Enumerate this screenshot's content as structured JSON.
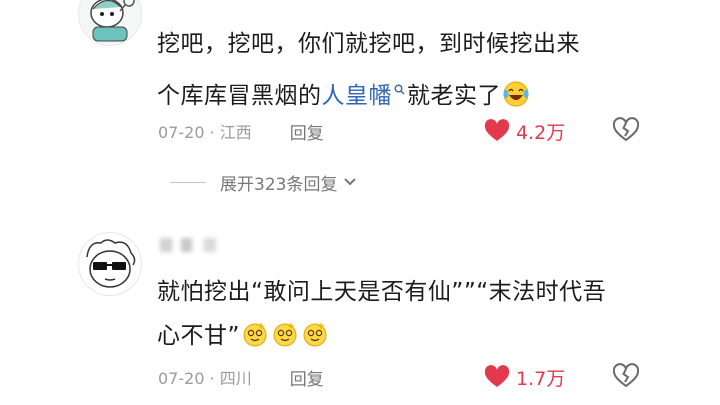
{
  "comments": [
    {
      "line1": "挖吧，挖吧，你们就挖吧，到时候挖出来",
      "line2_before": "个库库冒黑烟的",
      "line2_link": "人皇幡",
      "line2_after": "就老实了",
      "emoji": "laughing-tears",
      "date": "07-20 · 江西",
      "reply_label": "回复",
      "likes": "4.2万",
      "replies_toggle": "展开323条回复"
    },
    {
      "line1": "就怕挖出“敢问上天是否有仙””“末法时代吾",
      "line2": "心不甘”",
      "emoji": "dizzy-face",
      "emoji_count": 3,
      "date": "07-20 · 四川",
      "reply_label": "回复",
      "likes": "1.7万"
    }
  ],
  "colors": {
    "like": "#e23a4c",
    "link": "#2f67b6",
    "meta": "#9b9b9b"
  }
}
